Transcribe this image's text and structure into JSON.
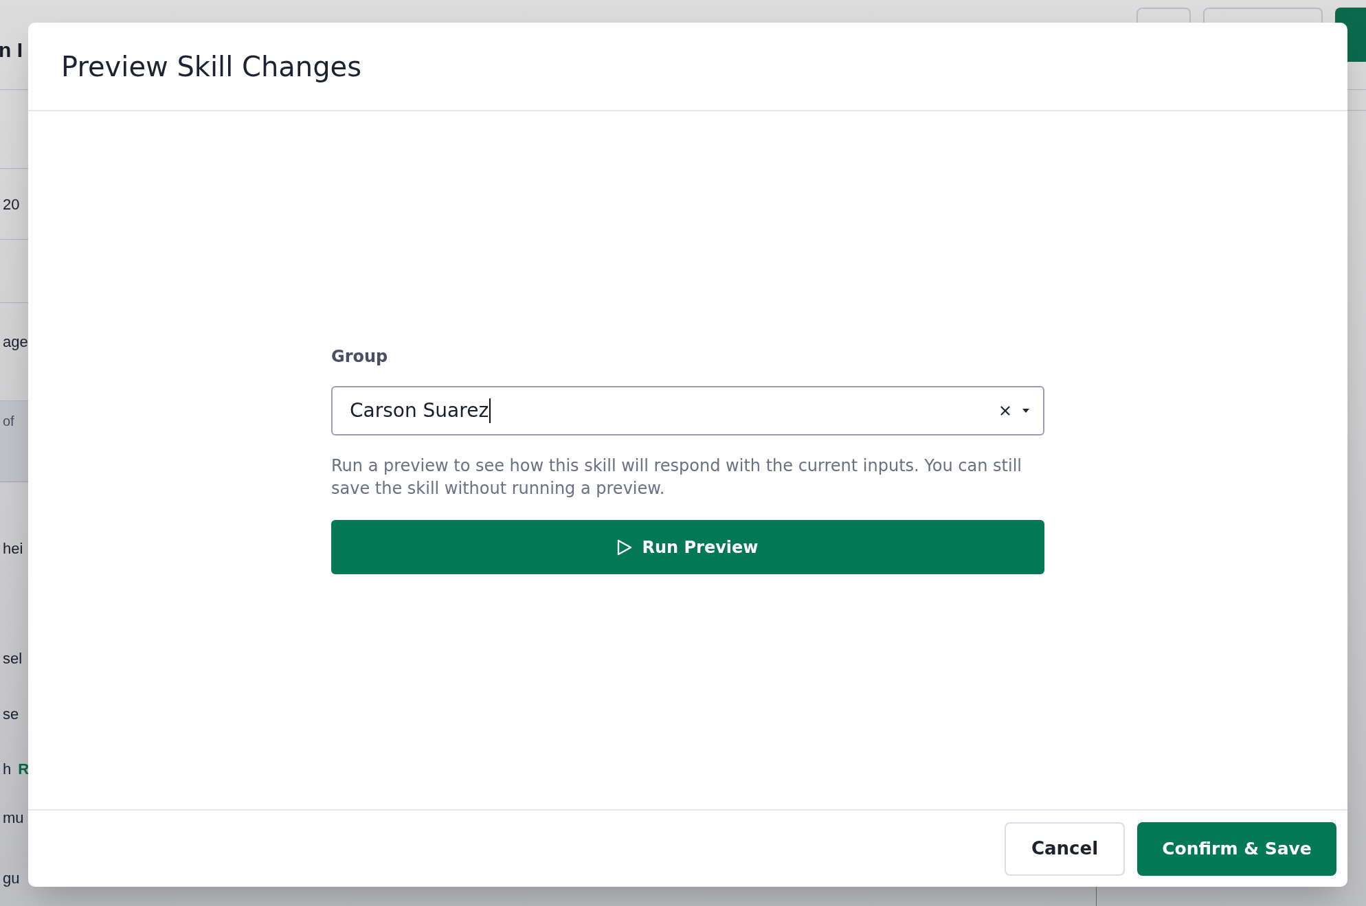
{
  "background": {
    "title": "n I",
    "lines": [
      {
        "text": "20",
        "kind": "cell"
      },
      {
        "text": "age",
        "kind": "cell"
      },
      {
        "text": "of",
        "kind": "note"
      },
      {
        "text": "hei",
        "kind": "body"
      },
      {
        "text": "sel",
        "kind": "body"
      },
      {
        "text": "se",
        "kind": "body"
      },
      {
        "text": "h",
        "kind": "body",
        "link": "R"
      },
      {
        "text": "mu",
        "kind": "body"
      },
      {
        "text": "gu",
        "kind": "body"
      }
    ]
  },
  "dialog": {
    "title": "Preview Skill Changes",
    "group_field": {
      "label": "Group",
      "value": "Carson Suarez",
      "focused": true
    },
    "help_text": "Run a preview to see how this skill will respond with the current inputs. You can still save the skill without running a preview.",
    "run_button": {
      "label": "Run Preview"
    },
    "buttons": [
      {
        "label": "Cancel",
        "kind": "secondary"
      },
      {
        "label": "Confirm & Save",
        "kind": "primary"
      }
    ]
  }
}
